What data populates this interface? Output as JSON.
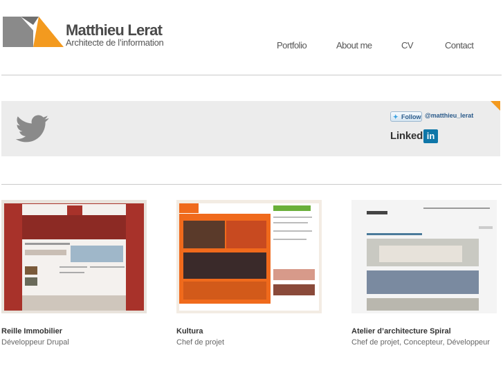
{
  "header": {
    "brand_name": "Matthieu Lerat",
    "brand_tagline": "Architecte de l’information",
    "nav": [
      "Portfolio",
      "About me",
      "CV",
      "Contact"
    ]
  },
  "social": {
    "follow_label": "Follow",
    "twitter_handle": "@matthieu_lerat",
    "linkedin_word": "Linked",
    "linkedin_box": "in"
  },
  "projects": [
    {
      "title": "Reille Immobilier",
      "role": "Développeur Drupal"
    },
    {
      "title": "Kultura",
      "role": "Chef de projet"
    },
    {
      "title": "Atelier d’architecture Spiral",
      "role": "Chef de projet, Concepteur, Développeur"
    }
  ],
  "colors": {
    "accent": "#f39a1f",
    "logo_gray": "#8a8a8a",
    "reille_red": "#a8322a",
    "kultura_orange": "#f06a1c"
  }
}
